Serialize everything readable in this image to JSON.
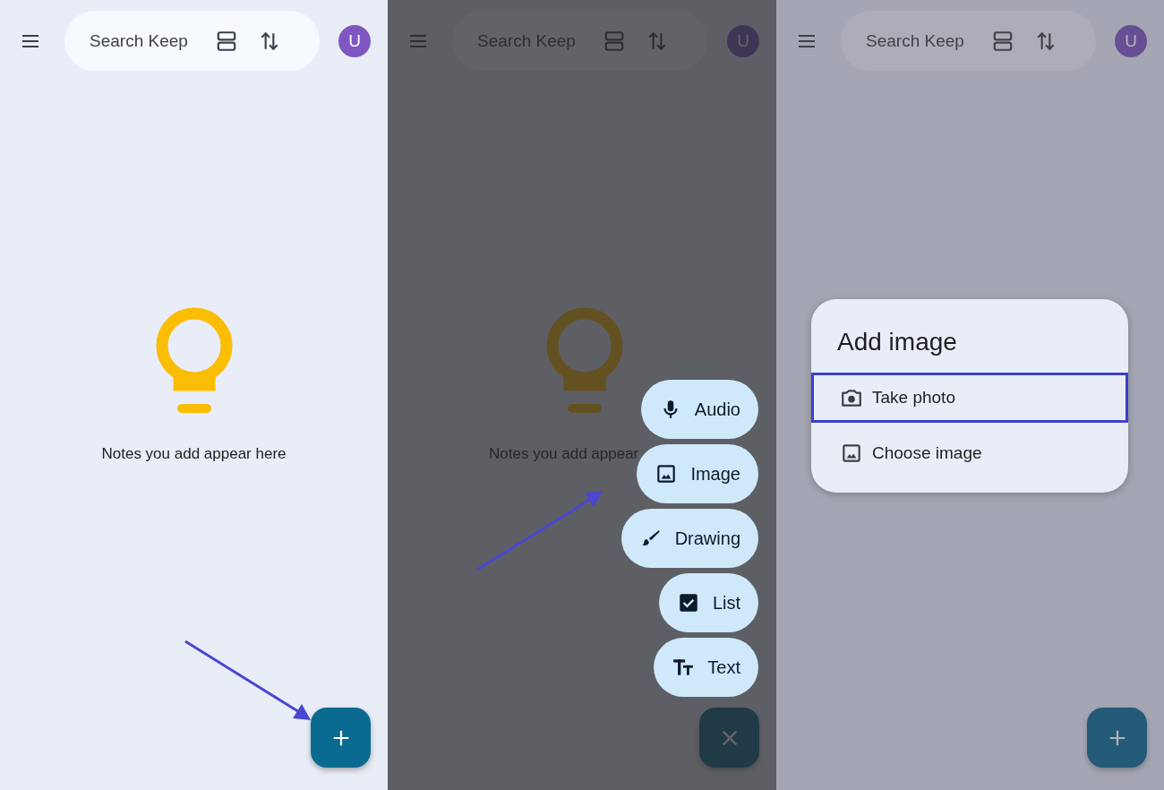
{
  "panels": [
    {
      "kind": "home",
      "header": {
        "search": {
          "placeholder": "Search Keep"
        },
        "avatar": "U"
      },
      "empty_state": {
        "text": "Notes you add appear here"
      },
      "fab": {
        "kind": "add"
      },
      "pointer_arrow": true
    },
    {
      "kind": "new_menu",
      "scrim": {
        "kind": "dark"
      },
      "header": {
        "search": {
          "placeholder": "Search Keep"
        },
        "avatar": "U"
      },
      "empty_state": {
        "text": "Notes you add appear"
      },
      "speed_dial": [
        {
          "kind": "audio",
          "label": "Audio"
        },
        {
          "kind": "image",
          "label": "Image"
        },
        {
          "kind": "drawing",
          "label": "Drawing"
        },
        {
          "kind": "list",
          "label": "List"
        },
        {
          "kind": "text",
          "label": "Text"
        }
      ],
      "fab": {
        "kind": "close"
      },
      "pointer_arrow": true
    },
    {
      "kind": "add_image",
      "scrim": {
        "kind": "light"
      },
      "header": {
        "search": {
          "placeholder": "Search Keep"
        },
        "avatar": "U"
      },
      "dialog": {
        "title": "Add image",
        "items": [
          {
            "kind": "camera",
            "label": "Take photo",
            "highlighted": true
          },
          {
            "kind": "image",
            "label": "Choose image",
            "highlighted": false
          }
        ]
      },
      "fab": {
        "kind": "add"
      }
    }
  ]
}
